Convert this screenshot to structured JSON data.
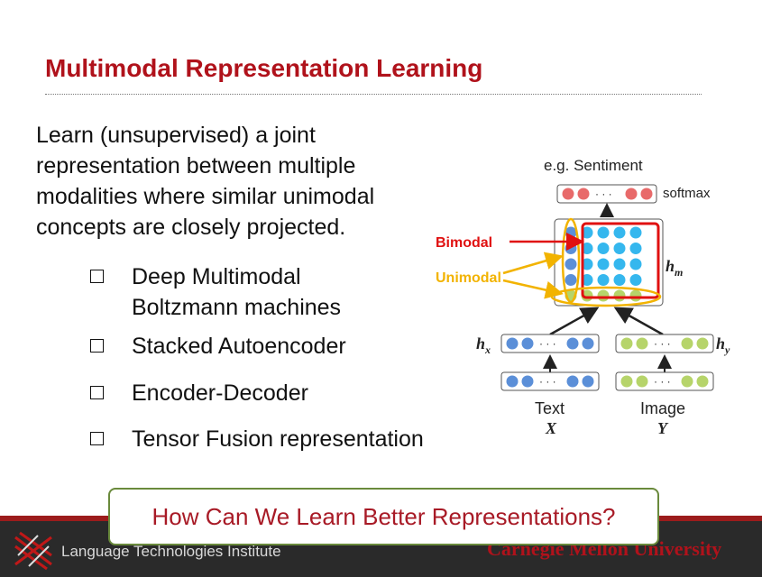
{
  "slide": {
    "title": "Multimodal Representation Learning",
    "paragraph": "Learn (unsupervised) a joint representation between multiple modalities where similar unimodal concepts are closely projected.",
    "bullets": [
      {
        "label": "Deep Multimodal Boltzmann machines"
      },
      {
        "label": "Stacked Autoencoder"
      },
      {
        "label": "Encoder-Decoder"
      },
      {
        "label": "Tensor Fusion representation"
      }
    ],
    "callout": "How Can We Learn Better Representations?"
  },
  "diagram": {
    "output_label": "e.g. Sentiment",
    "softmax_label": "softmax",
    "bimodal_label": "Bimodal",
    "unimodal_label": "Unimodal",
    "hm_label": "h_m",
    "hx_label": "h_x",
    "hy_label": "h_y",
    "text_label": "Text",
    "text_var": "X",
    "image_label": "Image",
    "image_var": "Y",
    "dots": "· · ·",
    "colors": {
      "bimodal": "#e01010",
      "unimodal": "#f2b300",
      "blue_node": "#5b8fd8",
      "cyan_node": "#35b7ee",
      "green_node": "#b6d46a",
      "red_node": "#e86a6a"
    }
  },
  "footer": {
    "institute": "Language Technologies Institute",
    "university": "Carnegie Mellon University"
  }
}
